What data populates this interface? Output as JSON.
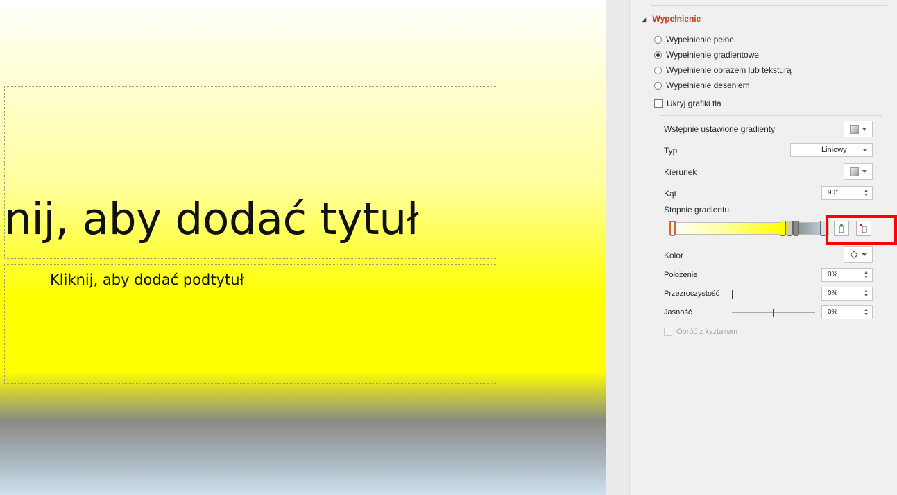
{
  "slide": {
    "title_placeholder": "nij, aby dodać tytuł",
    "subtitle_placeholder": "Kliknij, aby dodać podtytuł"
  },
  "pane": {
    "section_title": "Wypełnienie",
    "fill_options": [
      {
        "label": "Wypełnienie pełne",
        "checked": false
      },
      {
        "label": "Wypełnienie gradientowe",
        "checked": true
      },
      {
        "label": "Wypełnienie obrazem lub teksturą",
        "checked": false
      },
      {
        "label": "Wypełnienie deseniem",
        "checked": false
      }
    ],
    "hide_bg_graphics": {
      "label": "Ukryj grafiki tła",
      "checked": false
    },
    "preset_gradients_label": "Wstępnie ustawione gradienty",
    "type_label": "Typ",
    "type_value": "Liniowy",
    "direction_label": "Kierunek",
    "angle_label": "Kąt",
    "angle_value": "90°",
    "gradient_stops_label": "Stopnie gradientu",
    "color_label": "Kolor",
    "position_label": "Położenie",
    "position_value": "0%",
    "transparency_label": "Przezroczystość",
    "transparency_value": "0%",
    "brightness_label": "Jasność",
    "brightness_value": "0%",
    "rotate_with_shape": {
      "label": "Obróć z kształtem",
      "checked": false,
      "disabled": true
    }
  },
  "icons": {
    "add_stop": "add-gradient-stop-icon",
    "remove_stop": "remove-gradient-stop-icon",
    "paint_bucket": "paint-bucket-icon"
  },
  "colors": {
    "section_accent": "#c43e1c",
    "highlight_box": "#ff0000",
    "selected_stop": "#e0661f"
  },
  "sliders": {
    "transparency_level": 0,
    "brightness_level": 0.5
  }
}
